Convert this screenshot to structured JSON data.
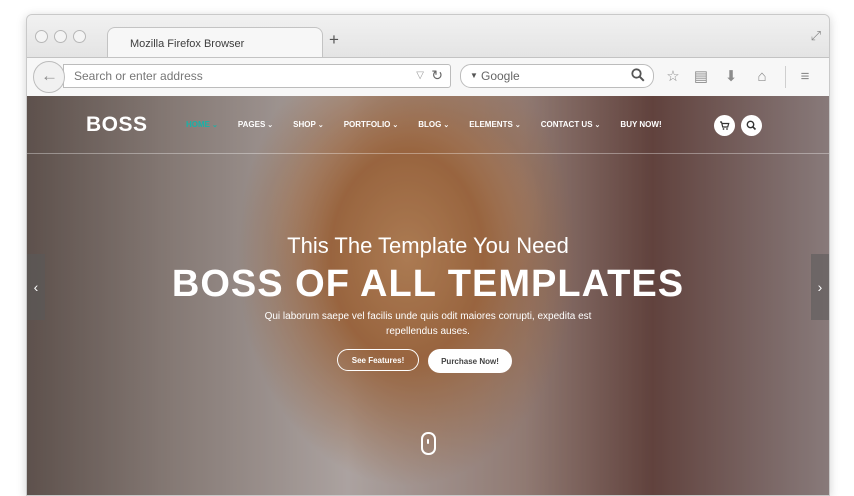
{
  "browser": {
    "tab_title": "Mozilla Firefox Browser",
    "new_tab_symbol": "+",
    "url_placeholder": "Search or enter address",
    "search_engine": "Google"
  },
  "site": {
    "brand": "BOSS",
    "menu": [
      {
        "label": "HOME",
        "active": true
      },
      {
        "label": "PAGES"
      },
      {
        "label": "SHOP"
      },
      {
        "label": "PORTFOLIO"
      },
      {
        "label": "BLOG"
      },
      {
        "label": "ELEMENTS"
      },
      {
        "label": "CONTACT US"
      },
      {
        "label": "BUY NOW!",
        "no_caret": true
      }
    ],
    "accent_color": "#18b2a8",
    "hero": {
      "tagline": "This The Template You Need",
      "headline": "BOSS OF ALL TEMPLATES",
      "blurb": "Qui laborum saepe vel facilis unde quis odit maiores corrupti, expedita est repellendus auses.",
      "btn_features": "See Features!",
      "btn_purchase": "Purchase Now!"
    }
  }
}
